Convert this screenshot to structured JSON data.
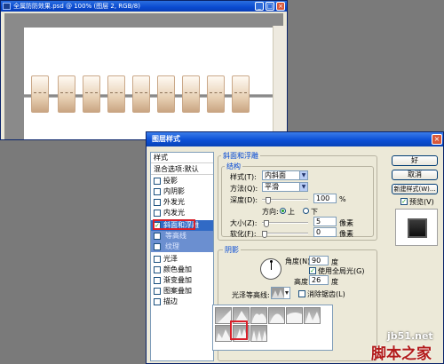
{
  "doc_window": {
    "title": "全属防防效果.psd @ 100% (图层 2, RGB/8)",
    "buttons": [
      "_",
      "□",
      "×"
    ]
  },
  "dialog": {
    "title": "图层样式",
    "close": "×",
    "styles_header": "样式",
    "blend_header": "混合选项:默认",
    "style_items": [
      {
        "label": "投影",
        "checked": false
      },
      {
        "label": "内阴影",
        "checked": false
      },
      {
        "label": "外发光",
        "checked": false
      },
      {
        "label": "内发光",
        "checked": false
      },
      {
        "label": "斜面和浮雕",
        "checked": true
      },
      {
        "label": "等高线",
        "checked": false
      },
      {
        "label": "纹理",
        "checked": false
      },
      {
        "label": "光泽",
        "checked": false
      },
      {
        "label": "颜色叠加",
        "checked": false
      },
      {
        "label": "渐变叠加",
        "checked": false
      },
      {
        "label": "图案叠加",
        "checked": false
      },
      {
        "label": "描边",
        "checked": false
      }
    ],
    "bevel": {
      "group_title": "斜面和浮雕",
      "structure_title": "结构",
      "style_label": "样式(T):",
      "style_value": "内斜面",
      "technique_label": "方法(Q):",
      "technique_value": "平滑",
      "depth_label": "深度(D):",
      "depth_value": "100",
      "depth_unit": "%",
      "direction_label": "方向:",
      "direction_up": "上",
      "direction_down": "下",
      "size_label": "大小(Z):",
      "size_value": "5",
      "size_unit": "像素",
      "soften_label": "软化(F):",
      "soften_value": "0",
      "soften_unit": "像素"
    },
    "shading": {
      "title": "阴影",
      "angle_label": "角度(N):",
      "angle_value": "90",
      "angle_unit": "度",
      "global_light_label": "使用全局光(G)",
      "altitude_label": "高度:",
      "altitude_value": "26",
      "altitude_unit": "度",
      "gloss_contour_label": "光泽等高线:",
      "antialias_label": "消除锯齿(L)"
    },
    "buttons": {
      "ok": "好",
      "cancel": "取消",
      "new_style": "新建样式(W)...",
      "preview_label": "预览(V)"
    }
  },
  "watermark": {
    "line1": "jb51.net",
    "line2": "脚本之家"
  },
  "colors": {
    "xp_blue": "#0c50d6",
    "selection": "#316ac5",
    "highlight_red": "#d8202a"
  }
}
